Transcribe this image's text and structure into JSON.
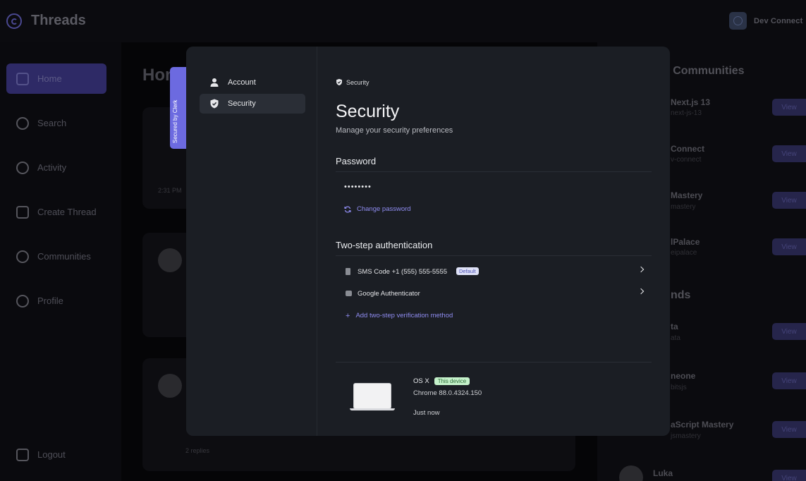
{
  "app": {
    "title": "Threads",
    "org_name": "Dev Connect"
  },
  "sidebar": {
    "items": [
      {
        "label": "Home",
        "icon": "home-icon",
        "active": true
      },
      {
        "label": "Search",
        "icon": "search-icon"
      },
      {
        "label": "Activity",
        "icon": "heart-icon"
      },
      {
        "label": "Create Thread",
        "icon": "create-thread-icon"
      },
      {
        "label": "Communities",
        "icon": "communities-icon"
      },
      {
        "label": "Profile",
        "icon": "user-icon"
      }
    ],
    "logout": "Logout"
  },
  "main": {
    "title": "Hom",
    "card1": {
      "time": "2:31 PM"
    },
    "card3": {
      "replies": "2 replies"
    }
  },
  "rightbar": {
    "communities_heading": "d Communities",
    "communities": [
      {
        "name": "Next.js 13",
        "handle": "next-js-13",
        "view": "View"
      },
      {
        "name": "Connect",
        "handle": "v-connect",
        "view": "View"
      },
      {
        "name": "Mastery",
        "handle": "mastery",
        "view": "View"
      },
      {
        "name": "lPalace",
        "handle": "eipalace",
        "view": "View"
      }
    ],
    "users_heading": "nds",
    "users": [
      {
        "name": "ta",
        "handle": "ata",
        "view": "View"
      },
      {
        "name": "neone",
        "handle": "bitsjs",
        "view": "View"
      },
      {
        "name": "aScript Mastery",
        "handle": "jsmastery",
        "view": "View"
      },
      {
        "name": "Luka",
        "handle": "",
        "view": "View"
      }
    ]
  },
  "modal": {
    "secured_by": "Secured by  Clerk",
    "nav": {
      "account": "Account",
      "security": "Security"
    },
    "breadcrumb": "Security",
    "title": "Security",
    "subtitle": "Manage your security preferences",
    "password": {
      "heading": "Password",
      "masked_value": "••••••••",
      "change_link": "Change password"
    },
    "two_step": {
      "heading": "Two-step authentication",
      "sms_label": "SMS Code +1 (555) 555-5555",
      "default_tag": "Default",
      "authenticator_label": "Google Authenticator",
      "add_link": "Add two-step verification method"
    },
    "device": {
      "os": "OS X",
      "this_device_tag": "This device",
      "browser": "Chrome 88.0.4324.150",
      "last_active": "Just now"
    }
  }
}
